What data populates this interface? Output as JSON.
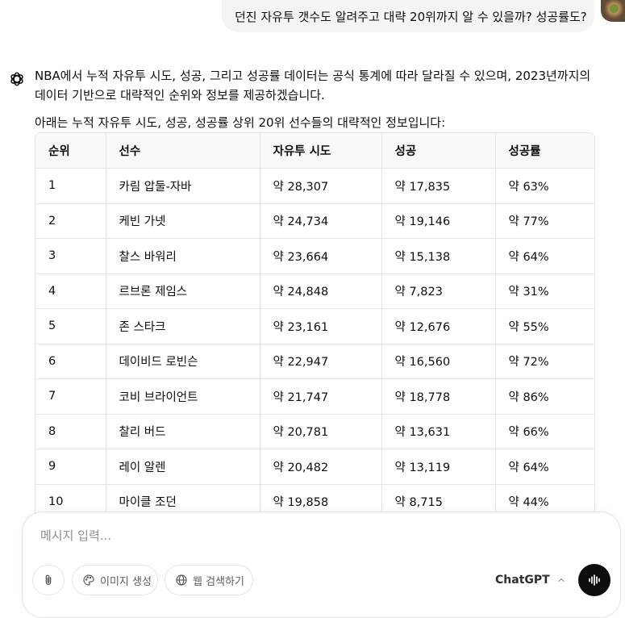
{
  "user_message": "던진 자유투 갯수도 알려주고 대략 20위까지 알 수 있을까? 성공률도?",
  "assistant": {
    "paragraph1": "NBA에서 누적 자유투 시도, 성공, 그리고 성공률 데이터는 공식 통계에 따라 달라질 수 있으며, 2023년까지의 데이터 기반으로 대략적인 순위와 정보를 제공하겠습니다.",
    "paragraph2": "아래는 누적 자유투 시도, 성공, 성공률 상위 20위 선수들의 대략적인 정보입니다:"
  },
  "table": {
    "headers": [
      "순위",
      "선수",
      "자유투 시도",
      "성공",
      "성공률"
    ],
    "rows": [
      [
        "1",
        "카림 압둘-자바",
        "약 28,307",
        "약 17,835",
        "약 63%"
      ],
      [
        "2",
        "케빈 가넷",
        "약 24,734",
        "약 19,146",
        "약 77%"
      ],
      [
        "3",
        "찰스 바워리",
        "약 23,664",
        "약 15,138",
        "약 64%"
      ],
      [
        "4",
        "르브론 제임스",
        "약 24,848",
        "약 7,823",
        "약 31%"
      ],
      [
        "5",
        "존 스타크",
        "약 23,161",
        "약 12,676",
        "약 55%"
      ],
      [
        "6",
        "데이비드 로빈슨",
        "약 22,947",
        "약 16,560",
        "약 72%"
      ],
      [
        "7",
        "코비 브라이언트",
        "약 21,747",
        "약 18,778",
        "약 86%"
      ],
      [
        "8",
        "찰리 버드",
        "약 20,781",
        "약 13,631",
        "약 66%"
      ],
      [
        "9",
        "레이 알렌",
        "약 20,482",
        "약 13,119",
        "약 64%"
      ],
      [
        "10",
        "마이클 조던",
        "약 19,858",
        "약 8,715",
        "약 44%"
      ]
    ]
  },
  "composer": {
    "placeholder": "메시지 입력...",
    "image_gen_label": "이미지 생성",
    "web_search_label": "웹 검색하기",
    "model_label": "ChatGPT"
  },
  "icons": {
    "attach": "paperclip-icon",
    "image_gen": "palette-icon",
    "web_search": "globe-icon",
    "model_chevron": "chevron-up-icon",
    "voice": "voice-waveform-icon",
    "assistant_logo": "openai-logo-icon"
  }
}
